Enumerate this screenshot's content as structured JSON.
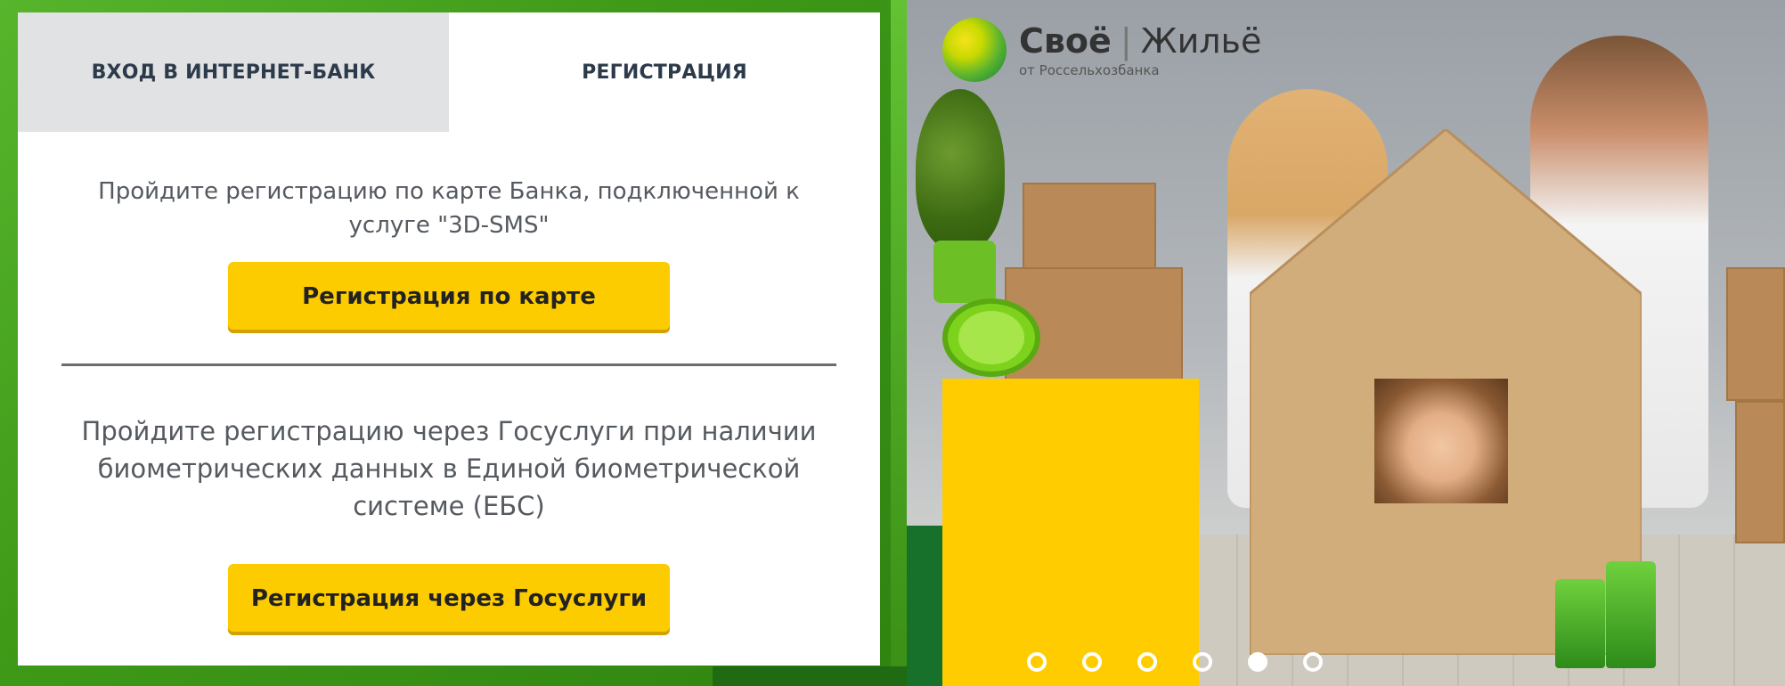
{
  "tabs": {
    "login_label": "ВХОД В ИНТЕРНЕТ-БАНК",
    "register_label": "РЕГИСТРАЦИЯ"
  },
  "registration": {
    "card_text": "Пройдите регистрацию по карте Банка, подключенной к услуге \"3D-SMS\"",
    "card_button": "Регистрация по карте",
    "gosuslugi_text": "Пройдите регистрацию через Госуслуги при наличии биометрических данных в Единой биометрической системе (ЕБС)",
    "gosuslugi_button": "Регистрация через Госуслуги"
  },
  "promo": {
    "logo_title_bold": "Своё",
    "logo_title_rest": "Жильё",
    "logo_subtitle": "от Россельхозбанка",
    "slides_count": 6,
    "active_slide": 5
  },
  "colors": {
    "accent_yellow": "#fccc00",
    "brand_green": "#3f9a18",
    "tab_inactive_bg": "#e0e2e4",
    "text_dark": "#2c3a4a"
  }
}
